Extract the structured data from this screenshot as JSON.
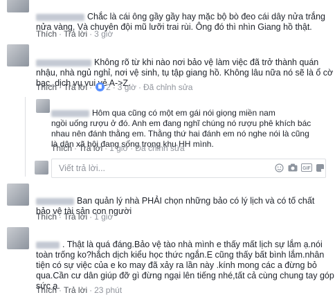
{
  "comments": [
    {
      "text": "Chắc là cái ông gầy gầy hay mặc bộ bò đeo cái dây nửa trắng\nnửa vàng. Và chuyên đội mũ lưỡi trai rùi. Ông đó thì nhìn Giang hồ thật.",
      "like": "Thích",
      "reply": "Trả lời",
      "time": "3 giờ"
    },
    {
      "text": "Không rõ từ khi nào nơi bảo vệ làm việc đã trở thành quán\nnhậu, nhà ngủ nghỉ, nơi vệ sinh, tụ tập giang hồ. Không lâu nữa nó sẽ là ổ cờ\nbạc, dịch vụ vui vẻ A->Z.",
      "like": "Thích",
      "reply": "Trả lời",
      "reactions": "2",
      "time": "3 giờ",
      "edited": "Đã chỉnh sửa"
    },
    {
      "text": "Ban quản lý nhà PHẢI chọn những bảo có lý lịch và có tố chất\nbảo vệ tài sản con người",
      "like": "Thích",
      "reply": "Trả lời",
      "time": "1 giờ"
    },
    {
      "text": ". Thật là quá đáng.Bảo vệ tào nhà mình e thấy mất lịch sự lắm ạ.nói\ntoàn trống ko?hắch dịch kiểu học thức ngắn.E cũng thấy bất bình lắm.nhân\ntiện có sự việc của e ko may đã xảy ra lần này .kính mong các a đừng bỏ\nqua.Cần cư dân giúp đỡ gì đừng ngại lên tiếng nhé,tất cả cùng chung tay góp\nsức ạ.",
      "like": "Thích",
      "reply": "Trả lời",
      "time": "23 phút"
    }
  ],
  "reply": {
    "text": "Hôm qua cũng có một em gái nói giọng miền nam\nngồi uống rượu ở đó. Anh em đang nghĩ chúng nó rượu phê khích bác\nnhau nên đánh thằng em. Thằng thứ hai đánh em nó nghe nói là cũng\nlà dân xã hội đang sống trong khu HH mình.",
    "like": "Thích",
    "reply": "Trả lời",
    "time": "1 giờ",
    "edited": "Đã chỉnh sửa"
  },
  "reply_input": {
    "placeholder": "Viết trả lời..."
  },
  "icons": {
    "emoji": "emoji-icon",
    "camera": "camera-icon",
    "gif": "gif-icon",
    "sticker": "sticker-icon"
  }
}
